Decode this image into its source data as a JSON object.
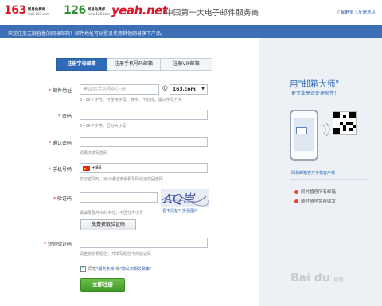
{
  "header": {
    "logo163": {
      "num": "163",
      "name": "网易免费邮",
      "domain": "mail.163.com"
    },
    "logo126": {
      "num": "126",
      "name": "网易免费邮",
      "domain": "www.126.com"
    },
    "logoyeah": {
      "num": "yeah.net"
    },
    "slogan": "中国第一大电子邮件服务商",
    "link_more": "了解更多",
    "link_feedback": "反馈意见"
  },
  "banner": {
    "text": "欢迎注册无限容量的网易邮箱！邮件地址可以登录使用其他网易旗下产品。"
  },
  "tabs": [
    {
      "label": "注册字母邮箱",
      "active": true
    },
    {
      "label": "注册手机号码邮箱",
      "active": false
    },
    {
      "label": "注册VIP邮箱",
      "active": false
    }
  ],
  "form": {
    "email_label": "邮件地址",
    "email_placeholder": "建议用手机号码注册",
    "email_at": "@",
    "email_domain": "163.com",
    "email_hint": "6~18个字符，可使用字母、数字、下划线，需以字母开头",
    "password_label": "密码",
    "password_hint": "6~16个字符，区分大小写",
    "confirm_label": "确认密码",
    "confirm_hint": "请再次填写密码",
    "phone_label": "手机号码",
    "phone_prefix": "+86-",
    "phone_hint": "忘记密码时，可以通过该手机号码快速找回密码",
    "captcha_label": "验证码",
    "captcha_text": "AQ岂",
    "captcha_refresh": "看不清楚？换张图片",
    "captcha_hint": "请填写图片中的字符，不区分大小写",
    "sms_button": "免费获取验证码",
    "sms_label": "短信验证码",
    "sms_hint": "请查收手机短信，并填写短信中的验证码",
    "agree_prefix": "同意",
    "agree_terms": "\"服务条款\"",
    "agree_and": "和",
    "agree_privacy": "\"隐私权相关政策\"",
    "submit": "立即注册"
  },
  "promo": {
    "title": "用\"邮箱大师\"",
    "subtitle": "更专业高效处理邮件！",
    "mini": "网易邮箱官方手机客户端",
    "features": [
      "同时管理所有邮箱",
      "随时随地免费收发"
    ]
  },
  "watermark": {
    "text": "Bai du",
    "sub": "经验"
  },
  "colors": {
    "accent": "#2f6ab6",
    "banner": "#3d6fb6",
    "submit": "#4aa82f",
    "required": "#ee2222"
  }
}
